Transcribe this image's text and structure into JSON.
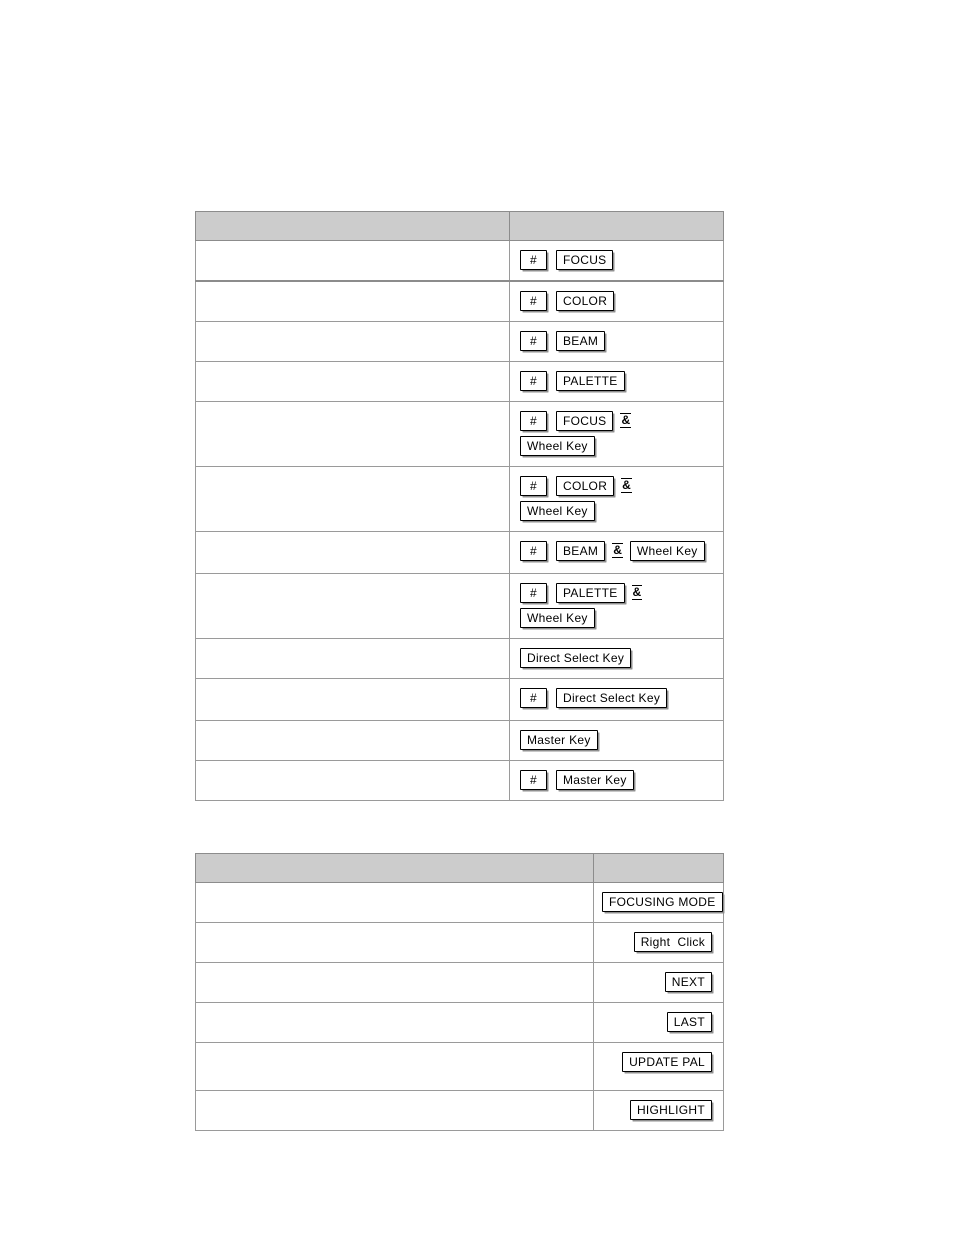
{
  "page": {
    "background": "#ffffff",
    "header_fill": "#cccccc",
    "border_color": "#9a9a9a",
    "key_border_color": "#000000",
    "key_shadow_color": "#8f8f8f"
  },
  "tables": [
    {
      "id": "table-shortcuts",
      "name": "console-key-shortcuts-table",
      "header": {
        "description": "",
        "keys": ""
      },
      "rows": [
        {
          "description": "",
          "keys": [
            [
              {
                "type": "key",
                "label": "#"
              },
              {
                "type": "key",
                "label": "FOCUS"
              }
            ]
          ]
        },
        {
          "description": "",
          "keys": [
            [
              {
                "type": "key",
                "label": "#"
              },
              {
                "type": "key",
                "label": "COLOR"
              }
            ]
          ]
        },
        {
          "description": "",
          "keys": [
            [
              {
                "type": "key",
                "label": "#"
              },
              {
                "type": "key",
                "label": "BEAM"
              }
            ]
          ]
        },
        {
          "description": "",
          "keys": [
            [
              {
                "type": "key",
                "label": "#"
              },
              {
                "type": "key",
                "label": "PALETTE"
              }
            ]
          ]
        },
        {
          "description": "",
          "keys": [
            [
              {
                "type": "key",
                "label": "#"
              },
              {
                "type": "key",
                "label": "FOCUS"
              },
              {
                "type": "amp",
                "label": "&"
              },
              {
                "type": "key",
                "label": "Wheel Key"
              }
            ]
          ]
        },
        {
          "description": "",
          "keys": [
            [
              {
                "type": "key",
                "label": "#"
              },
              {
                "type": "key",
                "label": "COLOR"
              },
              {
                "type": "amp",
                "label": "&"
              }
            ],
            [
              {
                "type": "key",
                "label": "Wheel Key"
              }
            ]
          ]
        },
        {
          "description": "",
          "keys": [
            [
              {
                "type": "key",
                "label": "#"
              },
              {
                "type": "key",
                "label": "BEAM"
              },
              {
                "type": "amp",
                "label": "&"
              },
              {
                "type": "key",
                "label": "Wheel Key"
              }
            ]
          ]
        },
        {
          "description": "",
          "keys": [
            [
              {
                "type": "key",
                "label": "#"
              },
              {
                "type": "key",
                "label": "PALETTE"
              },
              {
                "type": "amp",
                "label": "&"
              }
            ],
            [
              {
                "type": "key",
                "label": "Wheel Key"
              }
            ]
          ]
        },
        {
          "description": "",
          "keys": [
            [
              {
                "type": "key",
                "label": "Direct Select Key"
              }
            ]
          ]
        },
        {
          "description": "",
          "keys": [
            [
              {
                "type": "key",
                "label": "#"
              },
              {
                "type": "key",
                "label": "Direct Select Key"
              }
            ]
          ]
        },
        {
          "description": "",
          "keys": [
            [
              {
                "type": "key",
                "label": "Master Key"
              }
            ]
          ]
        },
        {
          "description": "",
          "keys": [
            [
              {
                "type": "key",
                "label": "#"
              },
              {
                "type": "key",
                "label": "Master Key"
              }
            ]
          ]
        }
      ]
    },
    {
      "id": "table-softkeys",
      "name": "softkey-functions-table",
      "header": {
        "description": "",
        "keys": ""
      },
      "rows": [
        {
          "description": "",
          "keys": [
            [
              {
                "type": "key",
                "label": "FOCUSING MODE"
              }
            ]
          ]
        },
        {
          "description": "",
          "keys": [
            [
              {
                "type": "key",
                "label": "Right  Click"
              }
            ]
          ]
        },
        {
          "description": "",
          "keys": [
            [
              {
                "type": "key",
                "label": "NEXT"
              }
            ]
          ]
        },
        {
          "description": "",
          "keys": [
            [
              {
                "type": "key",
                "label": "LAST"
              }
            ]
          ]
        },
        {
          "description": "",
          "keys": [
            [
              {
                "type": "key",
                "label": "UPDATE PAL"
              }
            ]
          ]
        },
        {
          "description": "",
          "keys": [
            [
              {
                "type": "key",
                "label": "HIGHLIGHT"
              }
            ]
          ]
        }
      ]
    }
  ]
}
